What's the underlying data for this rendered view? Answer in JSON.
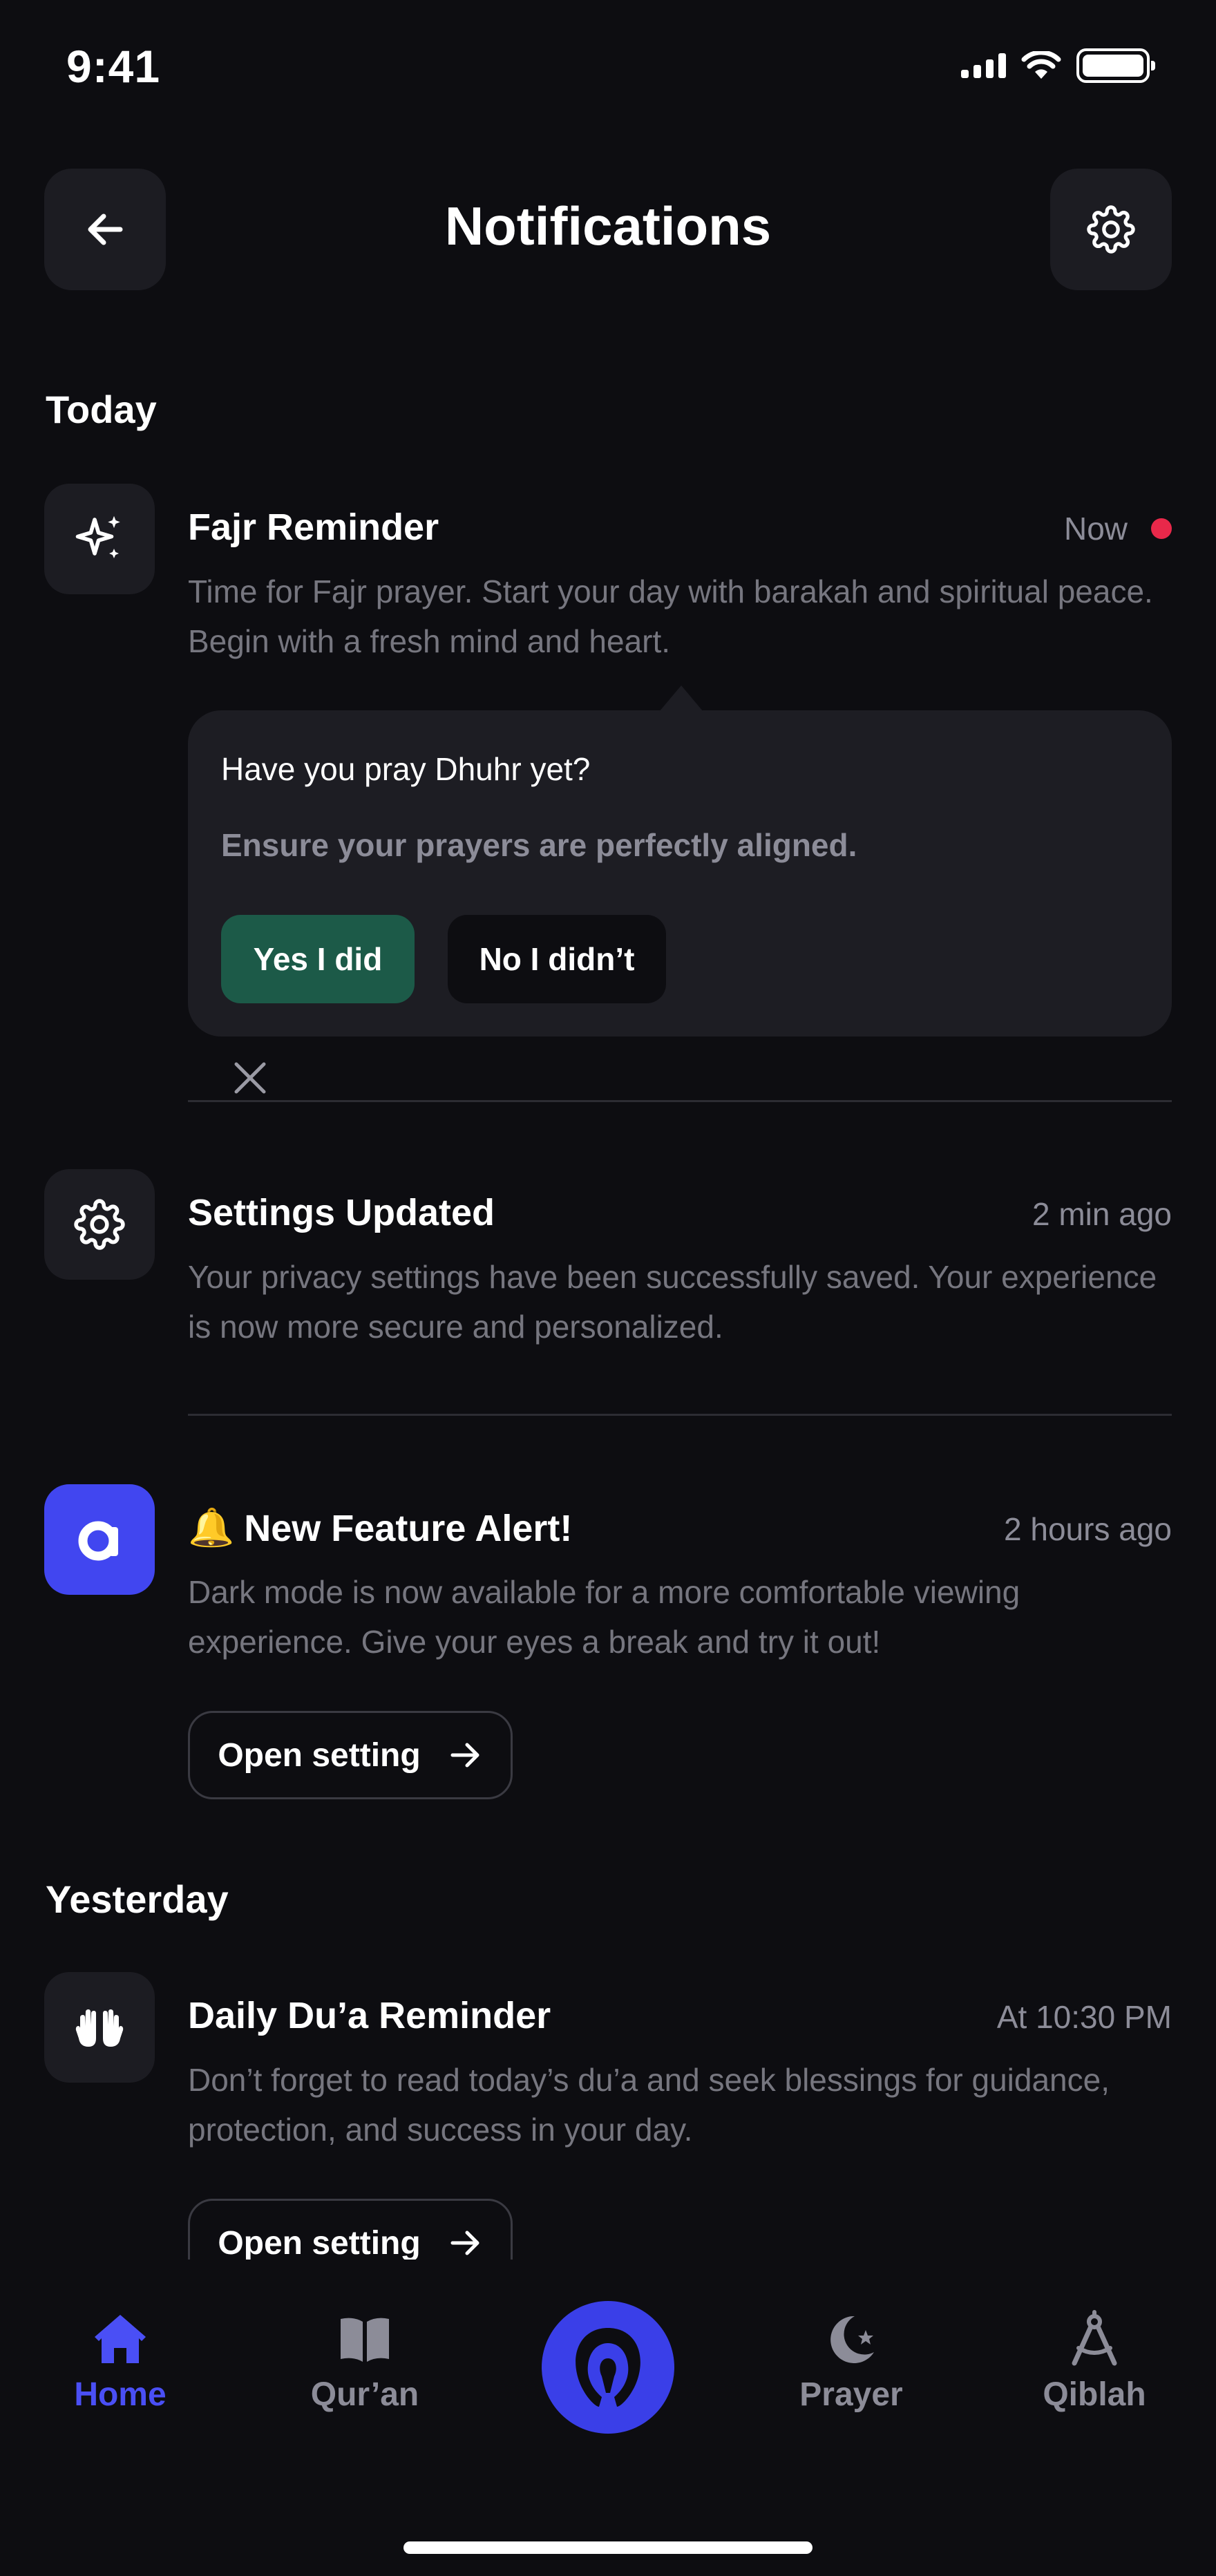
{
  "status_bar": {
    "time": "9:41"
  },
  "header": {
    "title": "Notifications"
  },
  "sections": {
    "today": "Today",
    "yesterday": "Yesterday"
  },
  "notifications": [
    {
      "title": "Fajr Reminder",
      "time": "Now",
      "unread": true,
      "body": "Time for Fajr prayer. Start your day with barakah and spiritual peace. Begin with a fresh mind and heart.",
      "icon": "sparkles-icon"
    },
    {
      "title": "Settings Updated",
      "time": "2 min ago",
      "body": "Your privacy settings have been successfully saved. Your experience is now more secure and personalized.",
      "icon": "gear-icon"
    },
    {
      "emoji": "🔔",
      "title": "New Feature Alert!",
      "time": "2 hours ago",
      "body": "Dark mode is now available for a more comfortable viewing experience. Give your eyes a break and try it out!",
      "icon": "app-logo-icon",
      "action": "Open setting"
    },
    {
      "title": "Daily Du’a Reminder",
      "time": "At 10:30 PM",
      "body": "Don’t forget to read today’s du’a and seek blessings for guidance, protection, and success in your day.",
      "icon": "praying-hands-icon",
      "action": "Open setting"
    }
  ],
  "prayer_prompt": {
    "question": "Have you pray Dhuhr yet?",
    "subtitle": "Ensure your prayers are perfectly aligned.",
    "yes_label": "Yes I did",
    "no_label": "No I didn’t"
  },
  "tab_bar": {
    "items": [
      {
        "label": "Home",
        "icon": "home-icon",
        "active": true
      },
      {
        "label": "Qur’an",
        "icon": "book-icon",
        "active": false
      },
      {
        "label": "",
        "icon": "app-logo-icon",
        "active": false
      },
      {
        "label": "Prayer",
        "icon": "crescent-star-icon",
        "active": false
      },
      {
        "label": "Qiblah",
        "icon": "compass-icon",
        "active": false
      }
    ]
  },
  "colors": {
    "background": "#0d0d11",
    "card": "#1d1d23",
    "accent": "#4a4ff5",
    "success": "#1c5a48",
    "unread": "#e8284a"
  }
}
